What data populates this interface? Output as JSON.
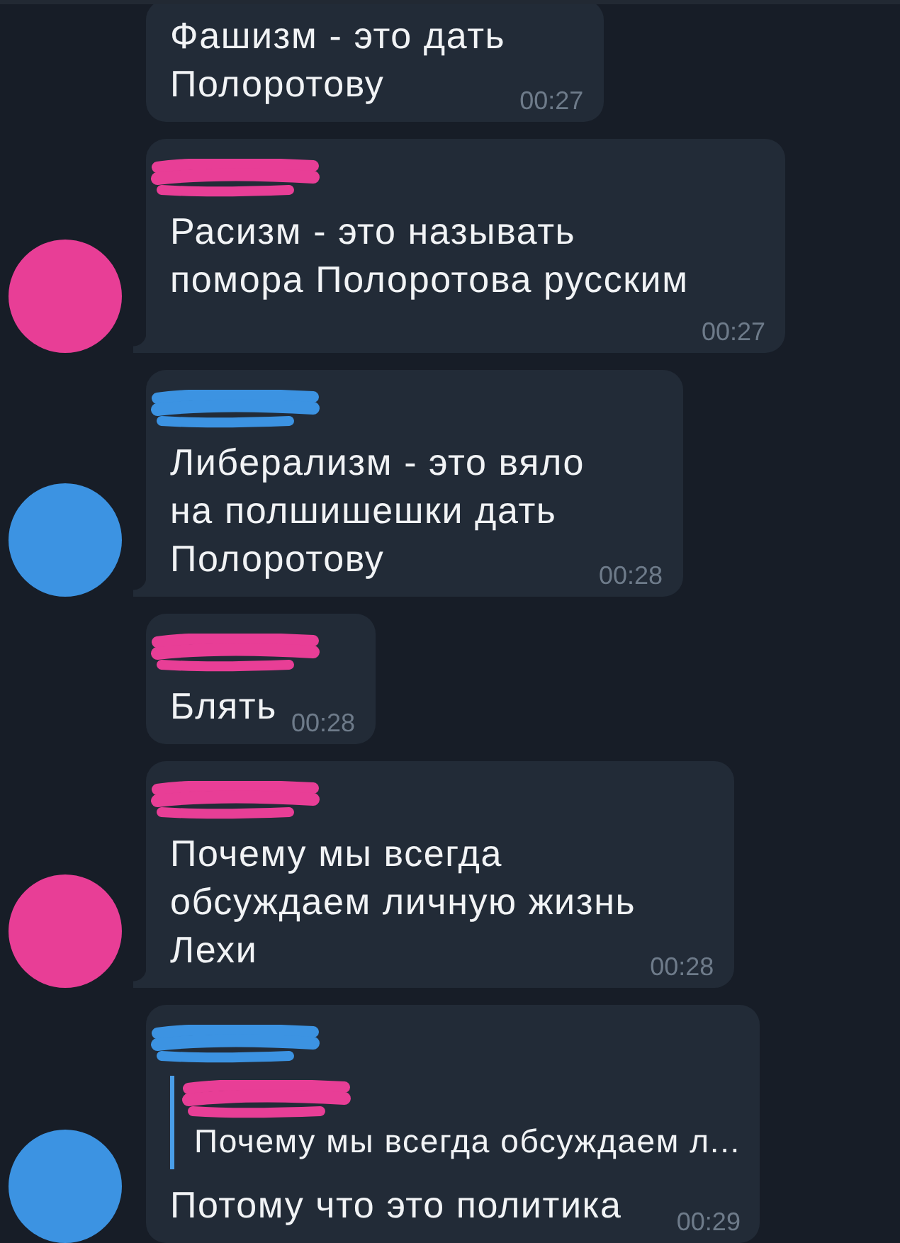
{
  "chat": {
    "messages": [
      {
        "avatar": false,
        "tail": false,
        "text": "Фашизм - это дать\nПолоротову",
        "time": "00:27"
      },
      {
        "sender": {
          "color": "#e83e96"
        },
        "avatar": true,
        "tail": true,
        "text": "Расизм - это называть\nпомора Полоротова русским",
        "time": "00:27"
      },
      {
        "sender": {
          "color": "#3c93e2"
        },
        "avatar": true,
        "tail": true,
        "text": "Либерализм - это вяло\nна полшишешки дать\nПолоротову",
        "time": "00:28"
      },
      {
        "sender": {
          "color": "#e83e96"
        },
        "avatar": false,
        "tail": false,
        "text": "Блять",
        "time": "00:28"
      },
      {
        "sender": {
          "color": "#e83e96"
        },
        "avatar": true,
        "tail": true,
        "text": "Почему мы всегда\nобсуждаем личную жизнь\nЛехи",
        "time": "00:28"
      },
      {
        "sender": {
          "color": "#3c93e2"
        },
        "avatar": true,
        "reply": {
          "color": "#e83e96",
          "text": "Почему мы всегда обсуждаем л..."
        },
        "text": "Потому что это политика",
        "time": "00:29"
      }
    ]
  }
}
